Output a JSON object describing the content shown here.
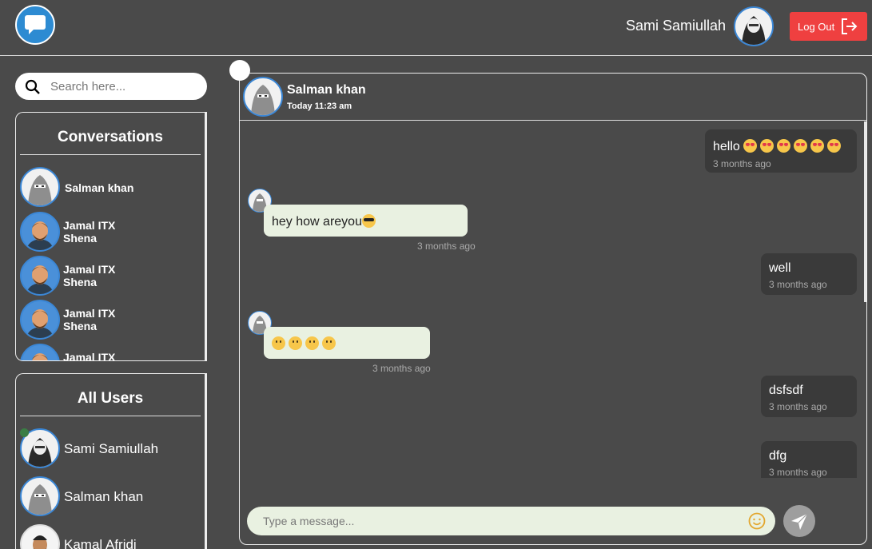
{
  "header": {
    "user_name": "Sami Samiullah",
    "logout_label": "Log Out"
  },
  "sidebar": {
    "search_placeholder": "Search here...",
    "conversations_title": "Conversations",
    "conversations": [
      {
        "name": "Salman khan",
        "avatar": "hijab-avatar"
      },
      {
        "name_line1": "Jamal ITX",
        "name_line2": "Shena",
        "avatar": "man-avatar"
      },
      {
        "name_line1": "Jamal ITX",
        "name_line2": "Shena",
        "avatar": "man-avatar"
      },
      {
        "name_line1": "Jamal ITX",
        "name_line2": "Shena",
        "avatar": "man-avatar"
      },
      {
        "name_line1": "Jamal ITX",
        "avatar": "man-avatar"
      }
    ],
    "users_title": "All Users",
    "users": [
      {
        "name": "Sami Samiullah",
        "online": true
      },
      {
        "name": "Salman khan",
        "online": false
      },
      {
        "name": "Kamal Afridi",
        "online": false
      }
    ]
  },
  "chat": {
    "contact_name": "Salman khan",
    "contact_time": "Today 11:23 am",
    "messages": [
      {
        "side": "sent",
        "text": "hello",
        "emoji": "heart-eyes x6",
        "time": "3 months ago"
      },
      {
        "side": "received",
        "text": "hey how areyou",
        "emoji": "sunglasses",
        "time": "3 months ago"
      },
      {
        "side": "sent",
        "text": "well",
        "time": "3 months ago"
      },
      {
        "side": "received",
        "text": "",
        "emoji": "frowning x4",
        "time": "3 months ago"
      },
      {
        "side": "sent",
        "text": "dsfsdf",
        "time": "3 months ago"
      },
      {
        "side": "sent",
        "text": "dfg",
        "time": "3 months ago"
      }
    ],
    "composer_placeholder": "Type a message..."
  },
  "colors": {
    "background": "#4a4a4a",
    "logout": "#ef4040",
    "accent_blue": "#3b87d6",
    "received_bubble": "#e9f1e1",
    "sent_bubble": "#3a3a3a",
    "online": "#3a7d44"
  }
}
